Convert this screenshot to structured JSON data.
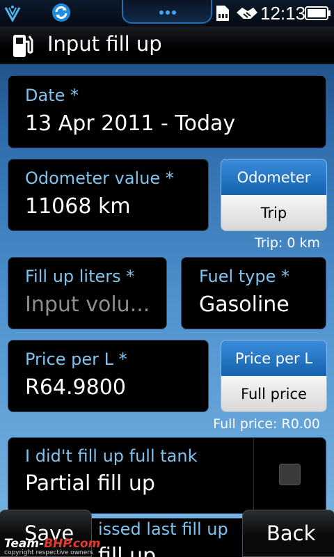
{
  "status": {
    "time": "12:13"
  },
  "title": "Input fill up",
  "date": {
    "label": "Date *",
    "value": "13 Apr 2011 - Today"
  },
  "odometer": {
    "label": "Odometer value *",
    "value": "11068 km",
    "toggle_top": "Odometer",
    "toggle_bottom": "Trip",
    "note": "Trip: 0 km"
  },
  "liters": {
    "label": "Fill up liters *",
    "placeholder": "Input volu..."
  },
  "fuel": {
    "label": "Fuel type *",
    "value": "Gasoline"
  },
  "price": {
    "label": "Price per L *",
    "value": "R64.9800",
    "toggle_top": "Price per L",
    "toggle_bottom": "Full price",
    "note": "Full price: R0.00"
  },
  "partial": {
    "label": "I did't fill up full tank",
    "value": "Partial fill up"
  },
  "missed": {
    "label": "issed last fill up",
    "value": "fill up"
  },
  "buttons": {
    "save": "Save",
    "back": "Back"
  },
  "watermark": {
    "brand_left": "Team-",
    "brand_right": "BHP.com",
    "copyright": "copyright respective owners"
  }
}
